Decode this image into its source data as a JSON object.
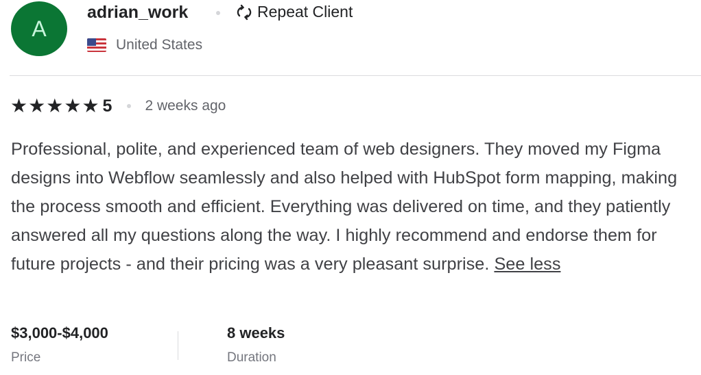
{
  "reviewer": {
    "avatar_letter": "A",
    "avatar_color": "#0b7634",
    "username": "adrian_work",
    "badge": "Repeat Client",
    "badge_icon": "repeat-icon",
    "country": "United States",
    "country_flag": "us-flag-icon"
  },
  "rating": {
    "stars": 5,
    "score": "5",
    "time_ago": "2 weeks ago"
  },
  "review": {
    "text": "Professional, polite, and experienced team of web designers. They moved my Figma designs into Webflow seamlessly and also helped with HubSpot form mapping, making the process smooth and efficient. Everything was delivered on time, and they patiently answered all my questions along the way. I highly recommend and endorse them for future projects - and their pricing was a very pleasant surprise.",
    "toggle_label": "See less"
  },
  "details": {
    "price_value": "$3,000-$4,000",
    "price_label": "Price",
    "duration_value": "8 weeks",
    "duration_label": "Duration"
  }
}
